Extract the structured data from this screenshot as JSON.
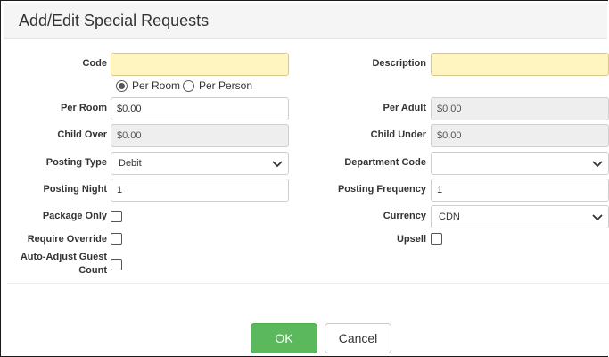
{
  "dialog": {
    "title": "Add/Edit Special Requests"
  },
  "form": {
    "code": {
      "label": "Code",
      "value": ""
    },
    "description": {
      "label": "Description",
      "value": ""
    },
    "rate_basis": {
      "options": [
        {
          "label": "Per Room",
          "selected": true
        },
        {
          "label": "Per Person",
          "selected": false
        }
      ]
    },
    "per_room": {
      "label": "Per Room",
      "value": "$0.00"
    },
    "per_adult": {
      "label": "Per Adult",
      "value": "$0.00"
    },
    "child_over": {
      "label": "Child Over",
      "value": "$0.00"
    },
    "child_under": {
      "label": "Child Under",
      "value": "$0.00"
    },
    "posting_type": {
      "label": "Posting Type",
      "value": "Debit"
    },
    "department_code": {
      "label": "Department Code",
      "value": ""
    },
    "posting_night": {
      "label": "Posting Night",
      "value": "1"
    },
    "posting_frequency": {
      "label": "Posting Frequency",
      "value": "1"
    },
    "package_only": {
      "label": "Package Only",
      "checked": false
    },
    "currency": {
      "label": "Currency",
      "value": "CDN"
    },
    "require_override": {
      "label": "Require Override",
      "checked": false
    },
    "upsell": {
      "label": "Upsell",
      "checked": false
    },
    "auto_adjust": {
      "label_line1": "Auto-Adjust Guest",
      "label_line2": "Count",
      "checked": false
    }
  },
  "footer": {
    "ok_label": "OK",
    "cancel_label": "Cancel"
  },
  "colors": {
    "required_bg": "#fff5c0",
    "ok_button": "#5cb85c",
    "disabled_bg": "#eeeeee"
  }
}
